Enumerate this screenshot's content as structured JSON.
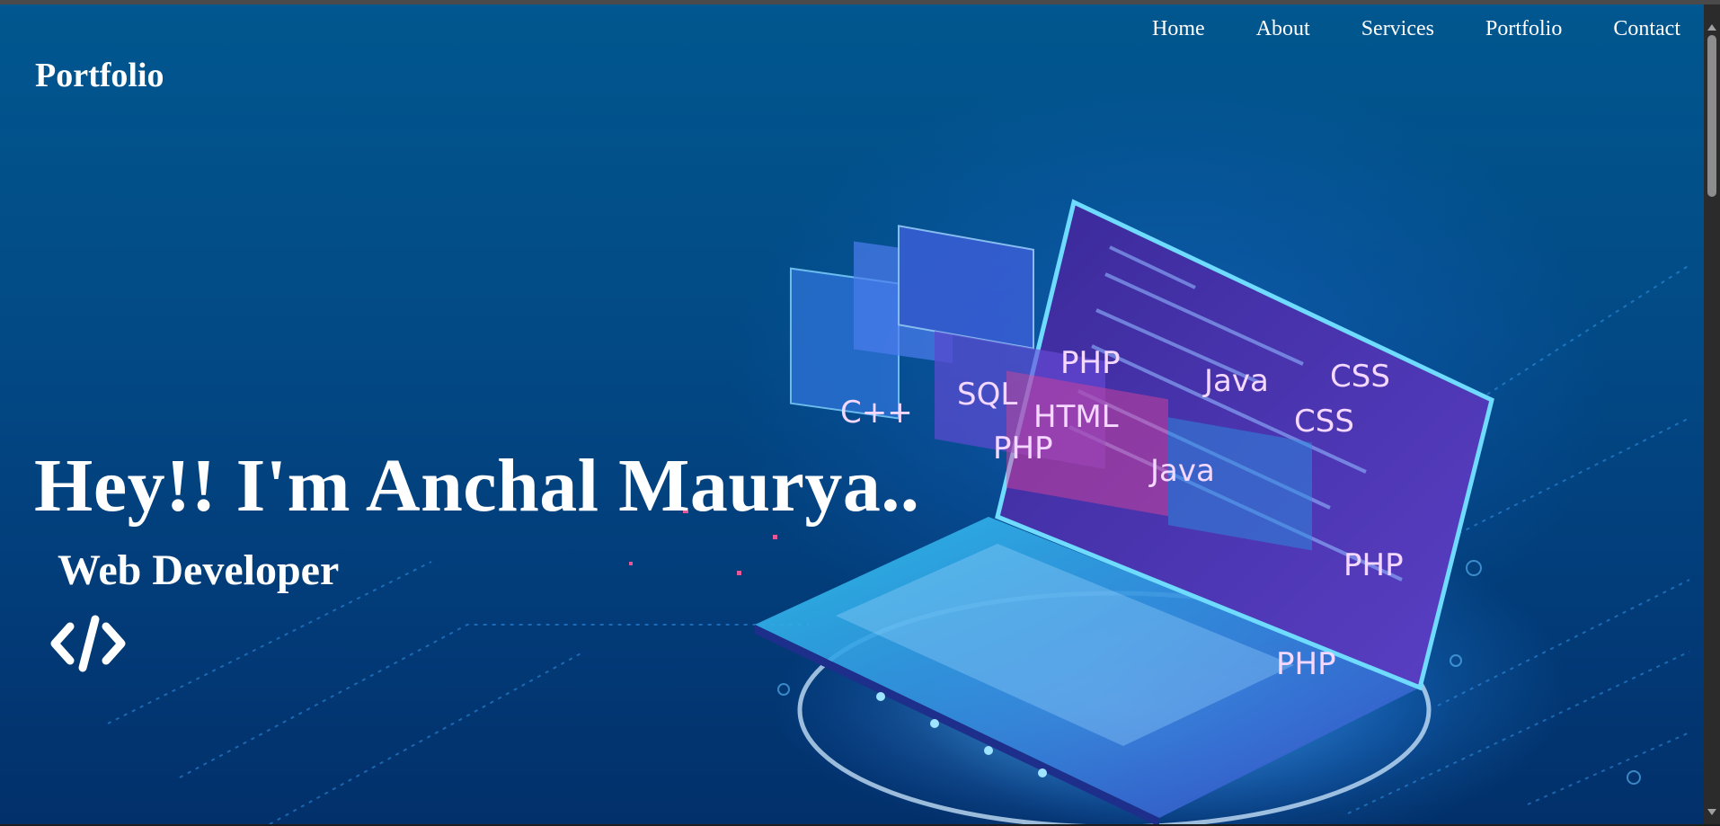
{
  "header": {
    "logo": "Portfolio"
  },
  "nav": {
    "items": [
      "Home",
      "About",
      "Services",
      "Portfolio",
      "Contact"
    ]
  },
  "hero": {
    "headline": "Hey!! I'm Anchal Maurya..",
    "subtitle": "Web Developer",
    "icon": "code-icon",
    "image_labels": [
      "PHP",
      "SQL",
      "Java",
      "CSS",
      "C++",
      "HTML",
      "PHP",
      "PHP",
      "CSS",
      "Java",
      "PHP"
    ]
  },
  "colors": {
    "background_top": "#01578f",
    "background_bottom": "#02306a",
    "text": "#ffffff",
    "glow": "#2896ff"
  }
}
